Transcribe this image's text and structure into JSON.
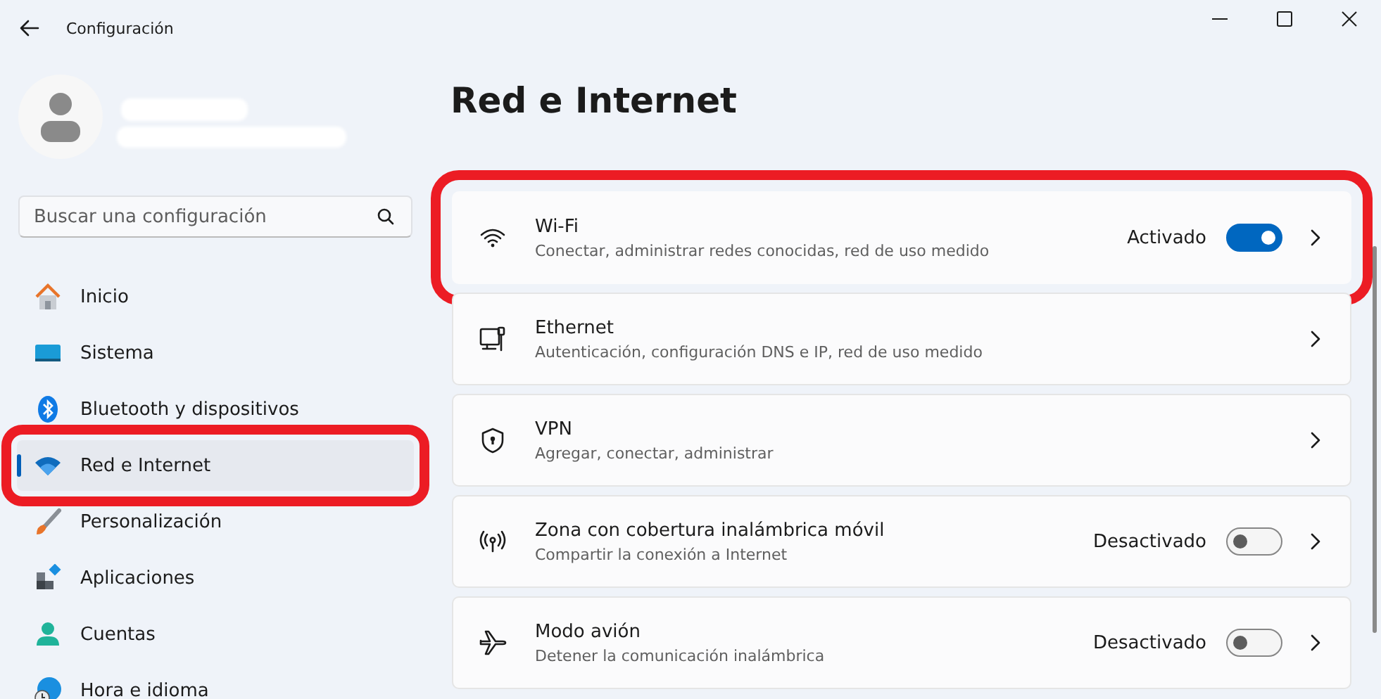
{
  "window": {
    "title": "Configuración"
  },
  "search": {
    "placeholder": "Buscar una configuración"
  },
  "sidebar": {
    "items": [
      {
        "label": "Inicio",
        "selected": false,
        "highlighted": false
      },
      {
        "label": "Sistema",
        "selected": false,
        "highlighted": false
      },
      {
        "label": "Bluetooth y dispositivos",
        "selected": false,
        "highlighted": false
      },
      {
        "label": "Red e Internet",
        "selected": true,
        "highlighted": true
      },
      {
        "label": "Personalización",
        "selected": false,
        "highlighted": false
      },
      {
        "label": "Aplicaciones",
        "selected": false,
        "highlighted": false
      },
      {
        "label": "Cuentas",
        "selected": false,
        "highlighted": false
      },
      {
        "label": "Hora e idioma",
        "selected": false,
        "highlighted": false
      }
    ]
  },
  "page": {
    "title": "Red e Internet"
  },
  "cards": [
    {
      "kind": "toggle",
      "title": "Wi-Fi",
      "subtitle": "Conectar, administrar redes conocidas, red de uso medido",
      "status": "Activado",
      "on": true,
      "highlighted": true
    },
    {
      "kind": "link",
      "title": "Ethernet",
      "subtitle": "Autenticación, configuración DNS e IP, red de uso medido",
      "highlighted": false
    },
    {
      "kind": "link",
      "title": "VPN",
      "subtitle": "Agregar, conectar, administrar",
      "highlighted": false
    },
    {
      "kind": "toggle",
      "title": "Zona con cobertura inalámbrica móvil",
      "subtitle": "Compartir la conexión a Internet",
      "status": "Desactivado",
      "on": false,
      "highlighted": false
    },
    {
      "kind": "toggle",
      "title": "Modo avión",
      "subtitle": "Detener la comunicación inalámbrica",
      "status": "Desactivado",
      "on": false,
      "highlighted": false
    }
  ]
}
